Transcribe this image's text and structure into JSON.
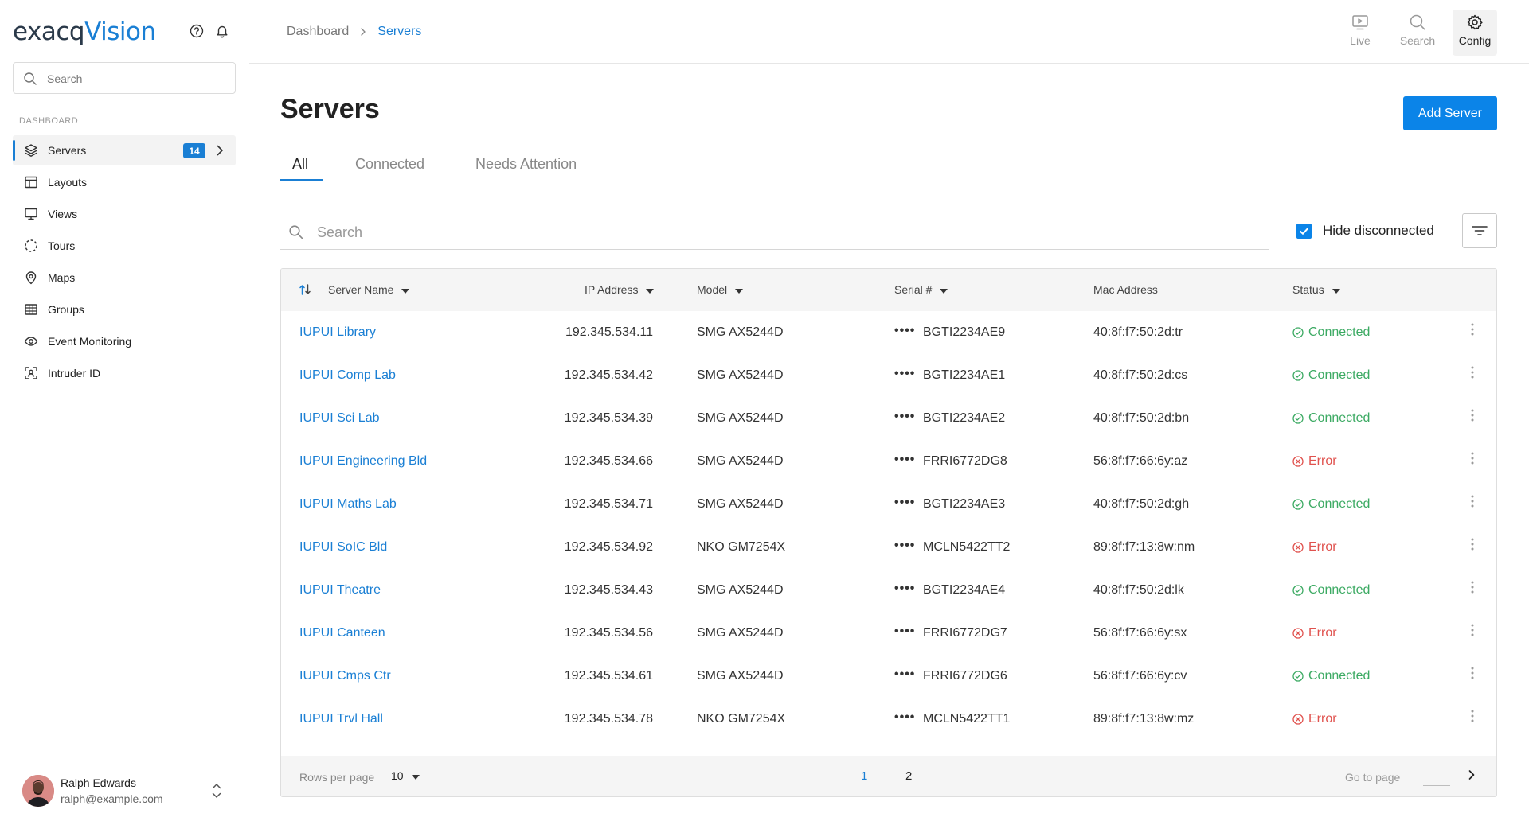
{
  "app": {
    "logo_text_a": "exacq",
    "logo_text_b": "Vision",
    "help_icon": "help-circle-icon",
    "bell_icon": "bell-icon"
  },
  "sidebar": {
    "search_placeholder": "Search",
    "section_label": "DASHBOARD",
    "items": [
      {
        "label": "Servers",
        "icon": "layers-icon",
        "badge": "14",
        "active": true
      },
      {
        "label": "Layouts",
        "icon": "layout-icon"
      },
      {
        "label": "Views",
        "icon": "monitor-icon"
      },
      {
        "label": "Tours",
        "icon": "tours-icon"
      },
      {
        "label": "Maps",
        "icon": "map-pin-icon"
      },
      {
        "label": "Groups",
        "icon": "grid-icon"
      },
      {
        "label": "Event Monitoring",
        "icon": "eye-icon"
      },
      {
        "label": "Intruder ID",
        "icon": "scan-user-icon"
      }
    ],
    "user": {
      "name": "Ralph Edwards",
      "email": "ralph@example.com"
    }
  },
  "header": {
    "breadcrumb": {
      "parent": "Dashboard",
      "current": "Servers"
    },
    "nav": [
      {
        "label": "Live",
        "icon": "play-screen-icon"
      },
      {
        "label": "Search",
        "icon": "search-icon"
      },
      {
        "label": "Config",
        "icon": "gear-icon",
        "active": true
      }
    ]
  },
  "main": {
    "title": "Servers",
    "add_button": "Add Server",
    "tabs": [
      "All",
      "Connected",
      "Needs Attention"
    ],
    "search_placeholder": "Search",
    "hide_disconnected_label": "Hide disconnected",
    "hide_disconnected_checked": true
  },
  "table": {
    "columns": {
      "name": "Server Name",
      "ip": "IP Address",
      "model": "Model",
      "serial": "Serial #",
      "mac": "Mac Address",
      "status": "Status"
    },
    "masked_serial_prefix": "••••",
    "rows": [
      {
        "name": "IUPUI Library",
        "ip": "192.345.534.11",
        "model": "SMG AX5244D",
        "serial": "BGTI2234AE9",
        "mac": "40:8f:f7:50:2d:tr",
        "status": "Connected",
        "ok": true
      },
      {
        "name": "IUPUI Comp Lab",
        "ip": "192.345.534.42",
        "model": "SMG AX5244D",
        "serial": "BGTI2234AE1",
        "mac": "40:8f:f7:50:2d:cs",
        "status": "Connected",
        "ok": true
      },
      {
        "name": "IUPUI Sci Lab",
        "ip": "192.345.534.39",
        "model": "SMG AX5244D",
        "serial": "BGTI2234AE2",
        "mac": "40:8f:f7:50:2d:bn",
        "status": "Connected",
        "ok": true
      },
      {
        "name": "IUPUI Engineering Bld",
        "ip": "192.345.534.66",
        "model": "SMG AX5244D",
        "serial": "FRRI6772DG8",
        "mac": "56:8f:f7:66:6y:az",
        "status": "Error",
        "ok": false
      },
      {
        "name": "IUPUI Maths Lab",
        "ip": "192.345.534.71",
        "model": "SMG AX5244D",
        "serial": "BGTI2234AE3",
        "mac": "40:8f:f7:50:2d:gh",
        "status": "Connected",
        "ok": true
      },
      {
        "name": "IUPUI SoIC Bld",
        "ip": "192.345.534.92",
        "model": "NKO GM7254X",
        "serial": "MCLN5422TT2",
        "mac": "89:8f:f7:13:8w:nm",
        "status": "Error",
        "ok": false
      },
      {
        "name": "IUPUI Theatre",
        "ip": "192.345.534.43",
        "model": "SMG AX5244D",
        "serial": "BGTI2234AE4",
        "mac": "40:8f:f7:50:2d:lk",
        "status": "Connected",
        "ok": true
      },
      {
        "name": "IUPUI Canteen",
        "ip": "192.345.534.56",
        "model": "SMG AX5244D",
        "serial": "FRRI6772DG7",
        "mac": "56:8f:f7:66:6y:sx",
        "status": "Error",
        "ok": false
      },
      {
        "name": "IUPUI Cmps Ctr",
        "ip": "192.345.534.61",
        "model": "SMG AX5244D",
        "serial": "FRRI6772DG6",
        "mac": "56:8f:f7:66:6y:cv",
        "status": "Connected",
        "ok": true
      },
      {
        "name": "IUPUI Trvl Hall",
        "ip": "192.345.534.78",
        "model": "NKO GM7254X",
        "serial": "MCLN5422TT1",
        "mac": "89:8f:f7:13:8w:mz",
        "status": "Error",
        "ok": false
      }
    ],
    "footer": {
      "rows_per_page_label": "Rows per page",
      "rows_per_page_value": "10",
      "pages": [
        "1",
        "2"
      ],
      "current_page": "1",
      "goto_label": "Go to page"
    }
  },
  "colors": {
    "accent": "#1a7fd4",
    "button": "#0b84e8",
    "connected": "#3caa63",
    "error": "#e0524e"
  }
}
